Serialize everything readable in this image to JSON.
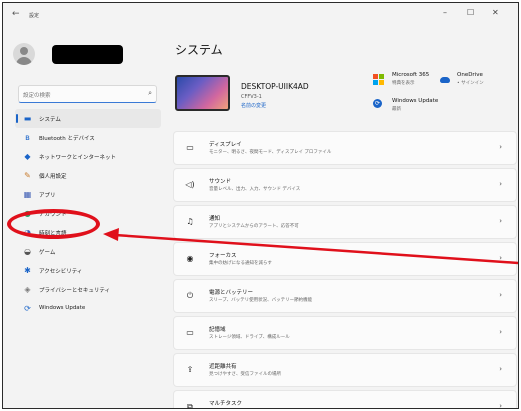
{
  "window": {
    "back_glyph": "←",
    "title": "設定",
    "minimize": "–",
    "maximize": "☐",
    "close": "✕"
  },
  "sidebar": {
    "search_placeholder": "設定の検索",
    "search_icon": "⌕",
    "items": [
      {
        "label": "システム",
        "icon": "monitor-icon",
        "glyph": "▬",
        "color": "#1a64c8"
      },
      {
        "label": "Bluetooth とデバイス",
        "icon": "bluetooth-icon",
        "glyph": "ʙ",
        "color": "#1a64c8"
      },
      {
        "label": "ネットワークとインターネット",
        "icon": "network-icon",
        "glyph": "◆",
        "color": "#1a64c8"
      },
      {
        "label": "個人用設定",
        "icon": "brush-icon",
        "glyph": "✎",
        "color": "#c77a2a"
      },
      {
        "label": "アプリ",
        "icon": "apps-icon",
        "glyph": "▦",
        "color": "#3b5bb3"
      },
      {
        "label": "アカウント",
        "icon": "account-icon",
        "glyph": "●",
        "color": "#2aa36b"
      },
      {
        "label": "時刻と言語",
        "icon": "time-language-icon",
        "glyph": "◔",
        "color": "#3b5bb3"
      },
      {
        "label": "ゲーム",
        "icon": "gamepad-icon",
        "glyph": "◒",
        "color": "#555555"
      },
      {
        "label": "アクセシビリティ",
        "icon": "accessibility-icon",
        "glyph": "✱",
        "color": "#1a64c8"
      },
      {
        "label": "プライバシーとセキュリティ",
        "icon": "shield-icon",
        "glyph": "◈",
        "color": "#777777"
      },
      {
        "label": "Windows Update",
        "icon": "update-icon",
        "glyph": "⟳",
        "color": "#1a64c8"
      }
    ]
  },
  "main": {
    "title": "システム",
    "device": {
      "name": "DESKTOP-UIIK4AD",
      "model": "CFFV3-1",
      "rename": "名前の変更"
    },
    "microsoft365": {
      "title": "Microsoft 365",
      "sub": "特典を表示",
      "colors": [
        "#f25022",
        "#7fba00",
        "#00a4ef",
        "#ffb900"
      ]
    },
    "onedrive": {
      "title": "OneDrive",
      "sub": "• サインイン"
    },
    "windows_update": {
      "title": "Windows Update",
      "sub": "最新",
      "glyph": "⟳"
    },
    "cards": [
      {
        "title": "ディスプレイ",
        "sub": "モニター、明るさ、夜間モード、ディスプレイ プロファイル",
        "icon": "display-icon",
        "glyph": "▭"
      },
      {
        "title": "サウンド",
        "sub": "音量レベル、出力、入力、サウンド デバイス",
        "icon": "speaker-icon",
        "glyph": "◁)"
      },
      {
        "title": "通知",
        "sub": "アプリとシステムからのアラート、応答不可",
        "icon": "bell-icon",
        "glyph": "♫"
      },
      {
        "title": "フォーカス",
        "sub": "集中の妨げになる通知を減らす",
        "icon": "focus-icon",
        "glyph": "◉"
      },
      {
        "title": "電源とバッテリー",
        "sub": "スリープ、バッテリ使用状況、バッテリー節約機能",
        "icon": "power-icon",
        "glyph": "⏻"
      },
      {
        "title": "記憶域",
        "sub": "ストレージ領域、ドライブ、構成ルール",
        "icon": "storage-icon",
        "glyph": "▭"
      },
      {
        "title": "近距離共有",
        "sub": "見つけやすさ、受信ファイルの場所",
        "icon": "share-icon",
        "glyph": "⇪"
      },
      {
        "title": "マルチタスク",
        "sub": "",
        "icon": "multitask-icon",
        "glyph": "⧉"
      }
    ],
    "chevron": "›"
  },
  "annotation": {
    "color": "#e0101b"
  }
}
